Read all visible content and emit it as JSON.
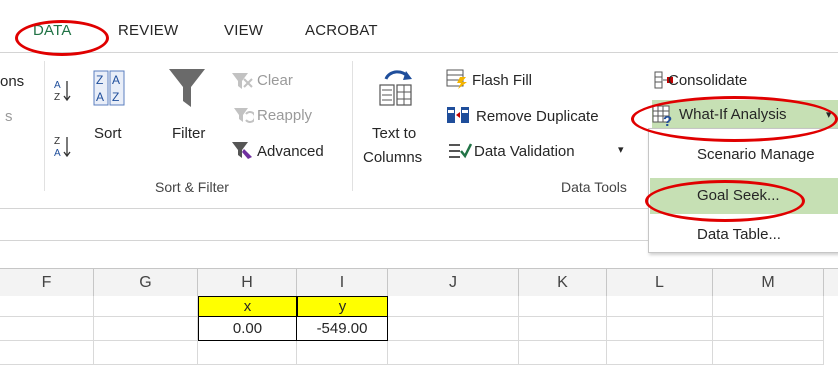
{
  "tabs": [
    {
      "label": "DATA",
      "active": true
    },
    {
      "label": "REVIEW",
      "active": false
    },
    {
      "label": "VIEW",
      "active": false
    },
    {
      "label": "ACROBAT",
      "active": false
    }
  ],
  "ribbon": {
    "partial_left_top": "ons",
    "partial_left_bottom": "s",
    "sort": "Sort",
    "filter": "Filter",
    "clear": "Clear",
    "reapply": "Reapply",
    "advanced": "Advanced",
    "sort_filter_group": "Sort & Filter",
    "text_to_columns_1": "Text to",
    "text_to_columns_2": "Columns",
    "flash_fill": "Flash Fill",
    "remove_duplicates": "Remove Duplicate",
    "data_validation": "Data Validation",
    "data_validation_arrow": "▾",
    "data_tools_group": "Data Tools",
    "consolidate": "Consolidate",
    "what_if": "What-If Analysis",
    "what_if_arrow": "▾"
  },
  "menu": {
    "items": [
      {
        "label": "Scenario Manage",
        "highlighted": false
      },
      {
        "label": "Goal Seek...",
        "highlighted": true
      },
      {
        "label": "Data Table...",
        "highlighted": false
      }
    ]
  },
  "columns": [
    "F",
    "G",
    "H",
    "I",
    "J",
    "K",
    "L",
    "M"
  ],
  "cells": {
    "h_header": "x",
    "i_header": "y",
    "h_value": "0.00",
    "i_value": "-549.00"
  },
  "colors": {
    "accent": "#217346",
    "highlight": "#c6e0b4",
    "annotation": "#e00000",
    "cell_yellow": "#ffff00"
  }
}
